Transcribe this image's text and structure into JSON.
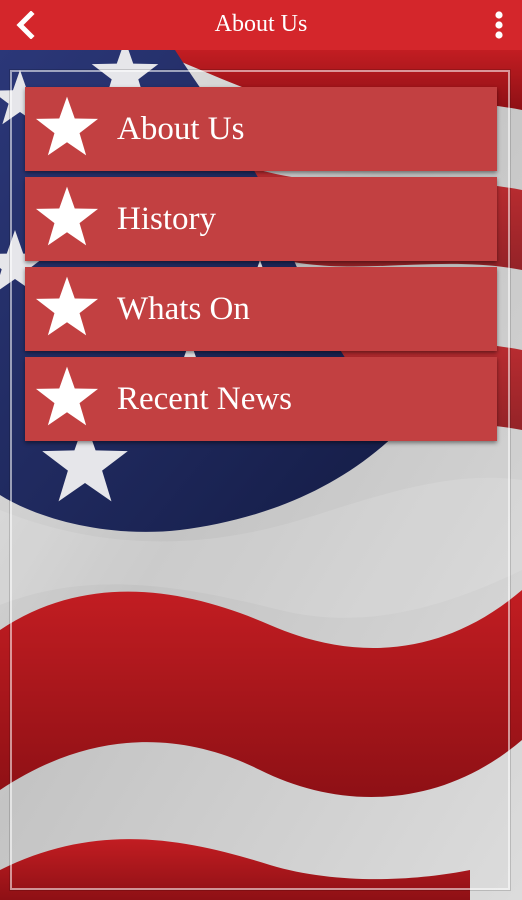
{
  "appbar": {
    "title": "About Us",
    "back_icon": "chevron-left-icon",
    "menu_icon": "more-vertical-icon"
  },
  "menu": {
    "items": [
      {
        "label": "About Us",
        "icon": "star-icon"
      },
      {
        "label": "History",
        "icon": "star-icon"
      },
      {
        "label": "Whats On",
        "icon": "star-icon"
      },
      {
        "label": "Recent News",
        "icon": "star-icon"
      }
    ]
  },
  "colors": {
    "appbar": "#d4262b",
    "menu_item": "#c24041",
    "text": "#ffffff",
    "flag_red": "#b5151b",
    "flag_blue": "#1f2a5e",
    "flag_white": "#d6d6d6"
  }
}
